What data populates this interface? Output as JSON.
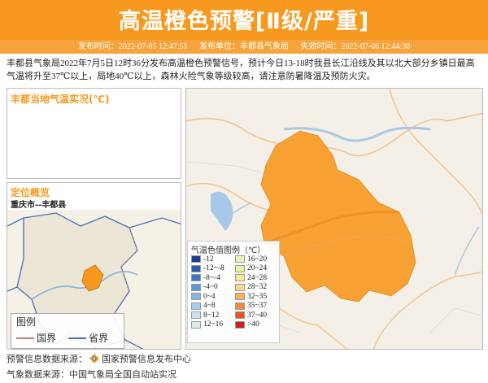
{
  "header": {
    "title": "高温橙色预警[Ⅱ级/严重]",
    "publish_time": "发布时间：2022-07-05 12:47:51",
    "publisher": "发布单位：丰都县气象局",
    "expire_time": "失效时间：2022-07-06 12:44:30",
    "color": "#f7991f"
  },
  "description": "丰都县气象局2022年7月5日12时36分发布高温橙色预警信号，预计今日13-18时我县长江沿线及其以北大部分乡镇日最高气温将升至37℃以上，局地40℃以上，森林火险气象等级较高，请注意防暑降温及预防火灾。",
  "temp_panel": {
    "title": "丰都当地气温实况(℃)"
  },
  "location_panel": {
    "title": "定位概览",
    "subtitle": "重庆市--丰都县",
    "legend_title": "图例",
    "legend_items": [
      {
        "label": "国界",
        "color": "#c77b7b"
      },
      {
        "label": "省界",
        "color": "#4a6fb5"
      }
    ]
  },
  "legend": {
    "title": "气温色值图例（℃）",
    "left": [
      {
        "label": "-12",
        "color": "#1e3c8c"
      },
      {
        "label": "-12~-8",
        "color": "#2a5aa8"
      },
      {
        "label": "-8~-4",
        "color": "#3b77c4"
      },
      {
        "label": "-4~0",
        "color": "#5a9ad8"
      },
      {
        "label": "0~4",
        "color": "#7fb7e6"
      },
      {
        "label": "4~8",
        "color": "#a4d0ef"
      },
      {
        "label": "8~12",
        "color": "#c8e4f2"
      },
      {
        "label": "12~16",
        "color": "#d9efe9"
      }
    ],
    "right": [
      {
        "label": "16~20",
        "color": "#e6f2b8"
      },
      {
        "label": "20~24",
        "color": "#eef39a"
      },
      {
        "label": "24~28",
        "color": "#f7ee8c"
      },
      {
        "label": "28~32",
        "color": "#f9d889"
      },
      {
        "label": "32~35",
        "color": "#f7b25f"
      },
      {
        "label": "35~37",
        "color": "#f38a3b"
      },
      {
        "label": "37~40",
        "color": "#e7541f"
      },
      {
        "label": ">40",
        "color": "#cc1f1a"
      }
    ]
  },
  "sources": {
    "warning": "预警信息数据来源：",
    "warning_org": "国家预警信息发布中心",
    "weather": "气象数据来源：中国气象局全国自动站实况"
  }
}
